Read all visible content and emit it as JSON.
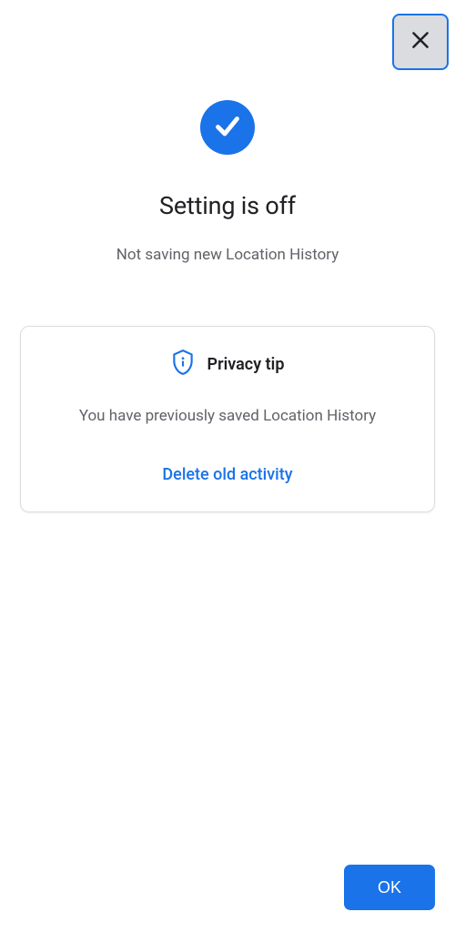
{
  "header": {
    "title": "Setting is off",
    "subtitle": "Not saving new Location History"
  },
  "privacy_card": {
    "heading": "Privacy tip",
    "body": "You have previously saved Location History",
    "action_label": "Delete old activity"
  },
  "buttons": {
    "ok": "OK"
  },
  "colors": {
    "primary": "#1a73e8",
    "text_primary": "#202124",
    "text_secondary": "#5f6368",
    "border": "#dadce0"
  }
}
